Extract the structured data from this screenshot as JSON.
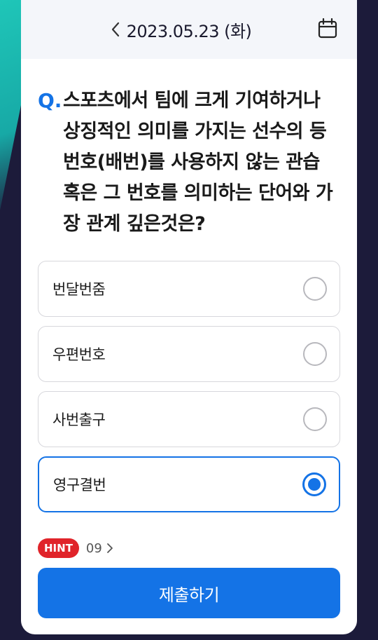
{
  "header": {
    "date": "2023.05.23 (화)",
    "back_icon": "chevron-left-icon",
    "calendar_icon": "calendar-icon"
  },
  "question": {
    "prefix": "Q.",
    "text": "스포츠에서 팀에 크게 기여하거나 상징적인 의미를 가지는 선수의 등 번호(배번)를 사용하지 않는 관습 혹은 그 번호를 의미하는 단어와 가장 관계 깊은것은?"
  },
  "options": [
    {
      "label": "번달번줌",
      "selected": false
    },
    {
      "label": "우편번호",
      "selected": false
    },
    {
      "label": "사번출구",
      "selected": false
    },
    {
      "label": "영구결번",
      "selected": true
    }
  ],
  "hint": {
    "badge": "HINT",
    "count": "09"
  },
  "submit_label": "제출하기",
  "colors": {
    "accent": "#1473e6",
    "hint": "#e0242a",
    "background": "#1c1b3a"
  }
}
